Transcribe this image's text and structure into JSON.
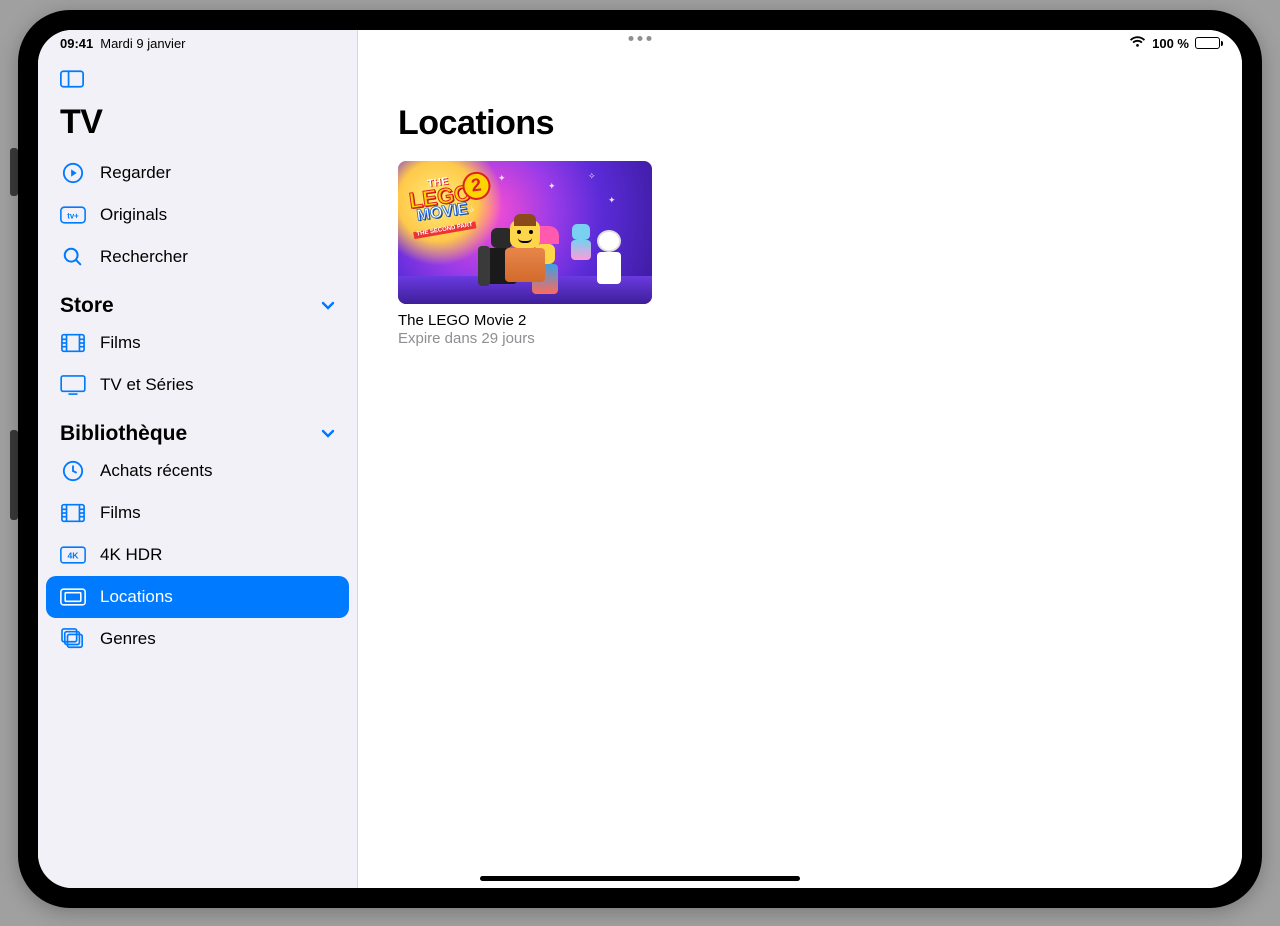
{
  "status": {
    "time": "09:41",
    "date": "Mardi 9 janvier",
    "battery_pct": "100 %"
  },
  "sidebar": {
    "app_title": "TV",
    "top_items": [
      {
        "label": "Regarder",
        "icon": "play-circle-icon"
      },
      {
        "label": "Originals",
        "icon": "atv-plus-icon"
      },
      {
        "label": "Rechercher",
        "icon": "search-icon"
      }
    ],
    "store": {
      "header": "Store",
      "items": [
        {
          "label": "Films",
          "icon": "film-icon"
        },
        {
          "label": "TV et Séries",
          "icon": "tv-screen-icon"
        }
      ]
    },
    "library": {
      "header": "Bibliothèque",
      "items": [
        {
          "label": "Achats récents",
          "icon": "clock-icon",
          "active": false
        },
        {
          "label": "Films",
          "icon": "film-icon",
          "active": false
        },
        {
          "label": "4K HDR",
          "icon": "4k-icon",
          "active": false
        },
        {
          "label": "Locations",
          "icon": "ticket-icon",
          "active": true
        },
        {
          "label": "Genres",
          "icon": "stack-icon",
          "active": false
        }
      ]
    }
  },
  "content": {
    "title": "Locations",
    "tiles": [
      {
        "title": "The LEGO Movie 2",
        "subtitle": "Expire dans 29 jours"
      }
    ]
  }
}
